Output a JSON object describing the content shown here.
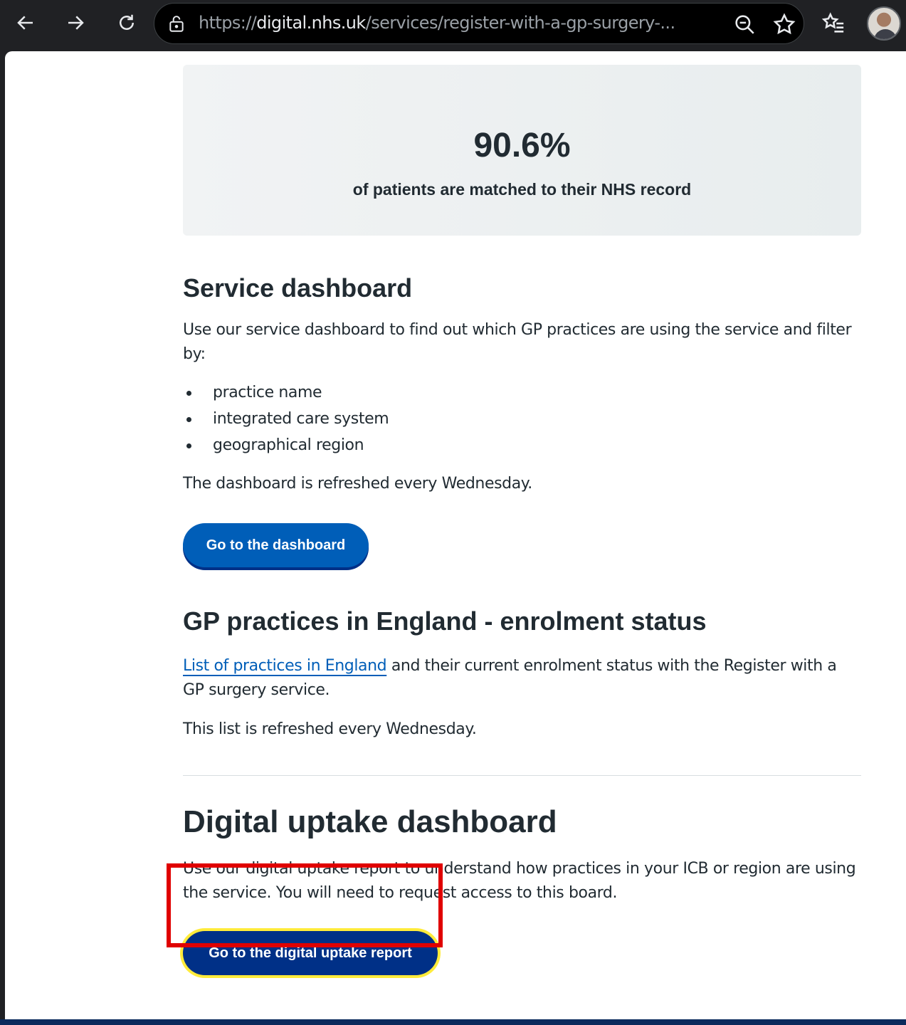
{
  "browser": {
    "url_scheme": "https://",
    "url_host": "digital.nhs.uk",
    "url_path": "/services/register-with-a-gp-surgery-...",
    "icons": [
      "back-arrow-icon",
      "forward-arrow-icon",
      "reload-icon",
      "site-info-icon",
      "zoom-icon",
      "bookmark-star-icon",
      "favorites-icon",
      "profile-avatar"
    ]
  },
  "stat": {
    "value": "90.6%",
    "label": "of patients are matched to their NHS record"
  },
  "service_dashboard": {
    "heading": "Service dashboard",
    "intro": "Use our service dashboard to find out which GP practices are using the service and filter by:",
    "filters": [
      "practice name",
      "integrated care system",
      "geographical region"
    ],
    "refresh_note": "The dashboard is refreshed every Wednesday.",
    "button_label": "Go to the dashboard"
  },
  "enrolment": {
    "heading": "GP practices in England - enrolment status",
    "link_text": "List of practices in England",
    "text_after_link": " and their current enrolment status with the Register with a GP surgery service.",
    "refresh_note": "This list is refreshed every Wednesday."
  },
  "digital_uptake": {
    "heading": "Digital uptake dashboard",
    "intro": "Use our digital uptake report to understand how practices in your ICB or region are using the service. You will need to request access to this board.",
    "button_label": "Go to the digital uptake report"
  },
  "colors": {
    "nhs_blue": "#005eb8",
    "nhs_dark_blue": "#003087",
    "focus_yellow": "#ffeb3b",
    "highlight_red": "#e00000"
  }
}
